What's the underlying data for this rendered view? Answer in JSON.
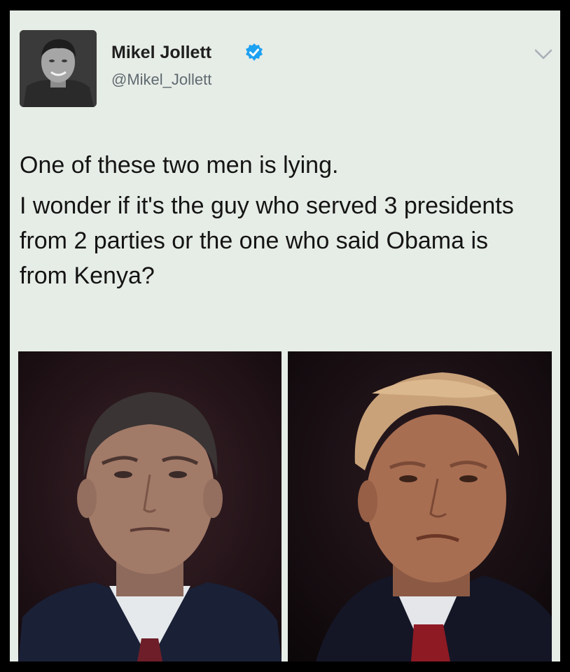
{
  "tweet": {
    "author_name": "Mikel Jollett",
    "author_handle": "@Mikel_Jollett",
    "verified": true,
    "text_line_1": "One of these two men is lying.",
    "text_line_2": "I wonder if it's the guy who served 3 presidents from 2 parties or the one who said Obama is from Kenya?"
  },
  "icons": {
    "verified": "verified-badge-icon",
    "menu": "chevron-down-icon"
  },
  "colors": {
    "card_background": "#e6ece6",
    "frame": "#000000",
    "verified_blue": "#1da1f2",
    "text": "#141414",
    "handle_text": "#606a70"
  }
}
